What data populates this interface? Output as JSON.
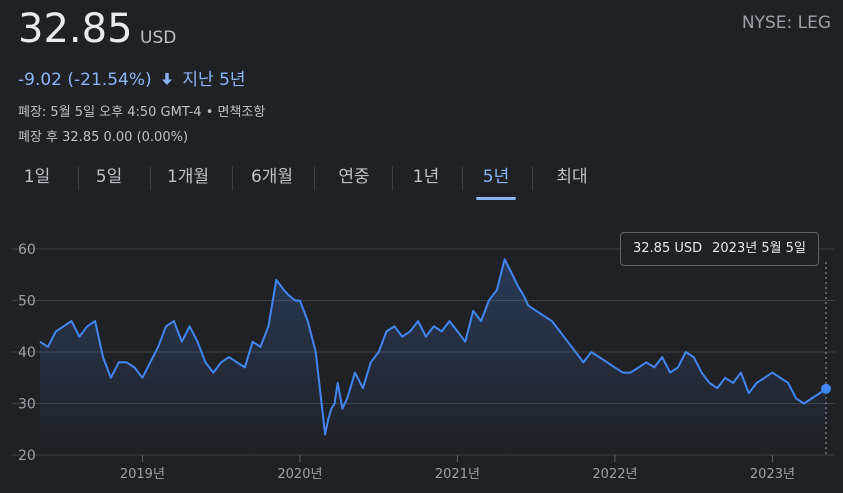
{
  "header": {
    "price": "32.85",
    "currency": "USD",
    "exchange": "NYSE: LEG",
    "change": "-9.02 (-21.54%)",
    "period": "지난 5년",
    "close_info": "폐장: 5월 5일 오후 4:50 GMT-4",
    "disclaimer": "면책조항",
    "after_hours": "폐장 후 32.85 0.00 (0.00%)"
  },
  "tabs": [
    {
      "label": "1일"
    },
    {
      "label": "5일"
    },
    {
      "label": "1개월"
    },
    {
      "label": "6개월"
    },
    {
      "label": "연중"
    },
    {
      "label": "1년"
    },
    {
      "label": "5년"
    },
    {
      "label": "최대"
    }
  ],
  "active_tab": 6,
  "tooltip": {
    "value": "32.85 USD",
    "date": "2023년 5월 5일"
  },
  "colors": {
    "line": "#4285f4",
    "accent": "#8ab4f8",
    "grid": "#3c4043"
  },
  "chart_data": {
    "type": "area",
    "x_ticks": [
      "2019년",
      "2020년",
      "2021년",
      "2022년",
      "2023년"
    ],
    "y_ticks": [
      20,
      30,
      40,
      50,
      60
    ],
    "ylim": [
      20,
      60
    ],
    "x": [
      2018.35,
      2018.4,
      2018.45,
      2018.5,
      2018.55,
      2018.6,
      2018.65,
      2018.7,
      2018.75,
      2018.8,
      2018.85,
      2018.9,
      2018.95,
      2019.0,
      2019.05,
      2019.1,
      2019.15,
      2019.2,
      2019.25,
      2019.3,
      2019.35,
      2019.4,
      2019.45,
      2019.5,
      2019.55,
      2019.6,
      2019.65,
      2019.7,
      2019.75,
      2019.8,
      2019.85,
      2019.9,
      2019.93,
      2019.97,
      2020.0,
      2020.05,
      2020.1,
      2020.13,
      2020.16,
      2020.18,
      2020.2,
      2020.22,
      2020.24,
      2020.27,
      2020.3,
      2020.35,
      2020.4,
      2020.45,
      2020.5,
      2020.55,
      2020.6,
      2020.65,
      2020.7,
      2020.75,
      2020.8,
      2020.85,
      2020.9,
      2020.95,
      2021.0,
      2021.05,
      2021.1,
      2021.15,
      2021.2,
      2021.25,
      2021.3,
      2021.35,
      2021.38,
      2021.42,
      2021.45,
      2021.5,
      2021.55,
      2021.6,
      2021.65,
      2021.7,
      2021.75,
      2021.8,
      2021.85,
      2021.9,
      2021.95,
      2022.0,
      2022.05,
      2022.1,
      2022.15,
      2022.2,
      2022.25,
      2022.3,
      2022.35,
      2022.4,
      2022.45,
      2022.5,
      2022.55,
      2022.6,
      2022.65,
      2022.7,
      2022.75,
      2022.8,
      2022.85,
      2022.9,
      2022.95,
      2023.0,
      2023.05,
      2023.1,
      2023.15,
      2023.2,
      2023.25,
      2023.3,
      2023.34
    ],
    "values": [
      42,
      41,
      44,
      45,
      46,
      43,
      45,
      46,
      39,
      35,
      38,
      38,
      37,
      35,
      38,
      41,
      45,
      46,
      42,
      45,
      42,
      38,
      36,
      38,
      39,
      38,
      37,
      42,
      41,
      45,
      54,
      52,
      51,
      50,
      50,
      46,
      40,
      32,
      24,
      27,
      29,
      30,
      34,
      29,
      31,
      36,
      33,
      38,
      40,
      44,
      45,
      43,
      44,
      46,
      43,
      45,
      44,
      46,
      44,
      42,
      48,
      46,
      50,
      52,
      58,
      55,
      53,
      51,
      49,
      48,
      47,
      46,
      44,
      42,
      40,
      38,
      40,
      39,
      38,
      37,
      36,
      36,
      37,
      38,
      37,
      39,
      36,
      37,
      40,
      39,
      36,
      34,
      33,
      35,
      34,
      36,
      32,
      34,
      35,
      36,
      35,
      34,
      31,
      30,
      31,
      32,
      32.85
    ]
  }
}
